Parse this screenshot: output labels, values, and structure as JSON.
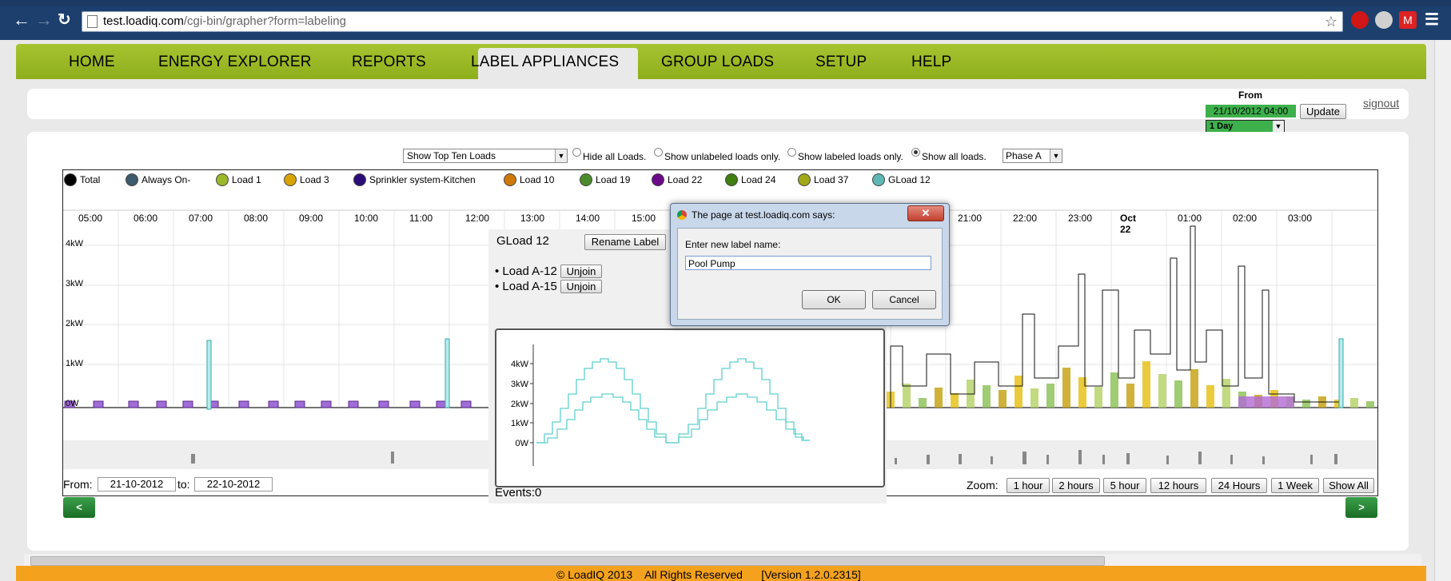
{
  "browser": {
    "url_host": "test.loadiq.com",
    "url_path": "/cgi-bin/grapher?form=labeling"
  },
  "nav": {
    "items": [
      "HOME",
      "ENERGY EXPLORER",
      "REPORTS",
      "LABEL APPLIANCES",
      "GROUP LOADS",
      "SETUP",
      "HELP"
    ],
    "active": "LABEL APPLIANCES"
  },
  "header": {
    "from_label": "From",
    "from_value": "21/10/2012 04:00",
    "update_label": "Update",
    "duration_value": "1 Day",
    "signout_label": "signout"
  },
  "filters": {
    "loads_select": "Show Top Ten Loads",
    "hide_all": "Hide all Loads.",
    "show_unlabeled": "Show unlabeled loads only.",
    "show_labeled": "Show labeled loads only.",
    "show_all": "Show all loads.",
    "phase_select": "Phase A"
  },
  "legend": [
    {
      "label": "Total",
      "color": "#000000"
    },
    {
      "label": "Always On-",
      "color": "#3d5a6c"
    },
    {
      "label": "Load 1",
      "color": "#9ab828"
    },
    {
      "label": "Load 3",
      "color": "#d9a400"
    },
    {
      "label": "Sprinkler system-Kitchen",
      "color": "#2a0d78"
    },
    {
      "label": "Load 10",
      "color": "#cf7a08"
    },
    {
      "label": "Load 19",
      "color": "#4c8b2b"
    },
    {
      "label": "Load 22",
      "color": "#6a0a8a"
    },
    {
      "label": "Load 24",
      "color": "#3f7f12"
    },
    {
      "label": "Load 37",
      "color": "#a0a818"
    },
    {
      "label": "GLoad 12",
      "color": "#5fb7b3"
    }
  ],
  "timeline": {
    "ticks": [
      "05:00",
      "06:00",
      "07:00",
      "08:00",
      "09:00",
      "10:00",
      "11:00",
      "12:00",
      "13:00",
      "14:00",
      "15:00",
      "21:00",
      "22:00",
      "23:00",
      "Oct 22",
      "01:00",
      "02:00",
      "03:00"
    ],
    "ylabels": [
      "4kW",
      "3kW",
      "2kW",
      "1kW",
      "0W"
    ]
  },
  "range": {
    "from_label": "From:",
    "from_value": "21-10-2012",
    "to_label": "to:",
    "to_value": "22-10-2012"
  },
  "zoom": {
    "label": "Zoom:",
    "buttons": [
      "1 hour",
      "2 hours",
      "5 hour",
      "12 hours",
      "24 Hours",
      "1 Week",
      "Show All"
    ]
  },
  "pager": {
    "prev": "<",
    "next": ">"
  },
  "gload": {
    "title": "GLoad 12",
    "rename_label": "Rename Label",
    "members": [
      {
        "name": "Load A-12",
        "action": "Unjoin"
      },
      {
        "name": "Load A-15",
        "action": "Unjoin"
      }
    ],
    "events": "Events:0",
    "ylabels": [
      "4kW",
      "3kW",
      "2kW",
      "1kW",
      "0W"
    ],
    "line_color": "#5fcfcf"
  },
  "dialog": {
    "title": "The page at test.loadiq.com says:",
    "prompt": "Enter new label name:",
    "value": "Pool Pump",
    "ok": "OK",
    "cancel": "Cancel"
  },
  "footer": {
    "text": "© LoadIQ 2013    All Rights Reserved      [Version 1.2.0.2315]"
  }
}
